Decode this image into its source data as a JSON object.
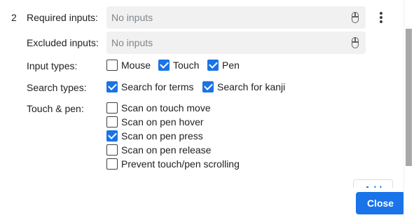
{
  "row": {
    "number": "2"
  },
  "required": {
    "label": "Required inputs:",
    "placeholder": "No inputs"
  },
  "excluded": {
    "label": "Excluded inputs:",
    "placeholder": "No inputs"
  },
  "input_types": {
    "label": "Input types:",
    "options": [
      {
        "label": "Mouse",
        "checked": false
      },
      {
        "label": "Touch",
        "checked": true
      },
      {
        "label": "Pen",
        "checked": true
      }
    ]
  },
  "search_types": {
    "label": "Search types:",
    "options": [
      {
        "label": "Search for terms",
        "checked": true
      },
      {
        "label": "Search for kanji",
        "checked": true
      }
    ]
  },
  "touch_pen": {
    "label": "Touch & pen:",
    "options": [
      {
        "label": "Scan on touch move",
        "checked": false
      },
      {
        "label": "Scan on pen hover",
        "checked": false
      },
      {
        "label": "Scan on pen press",
        "checked": true
      },
      {
        "label": "Scan on pen release",
        "checked": false
      },
      {
        "label": "Prevent touch/pen scrolling",
        "checked": false
      }
    ]
  },
  "buttons": {
    "add": "Add",
    "close": "Close"
  },
  "icons": {
    "menu": "more-vert-icon",
    "input": "mouse-icon",
    "check": "check-icon"
  },
  "colors": {
    "accent": "#1a73e8"
  }
}
